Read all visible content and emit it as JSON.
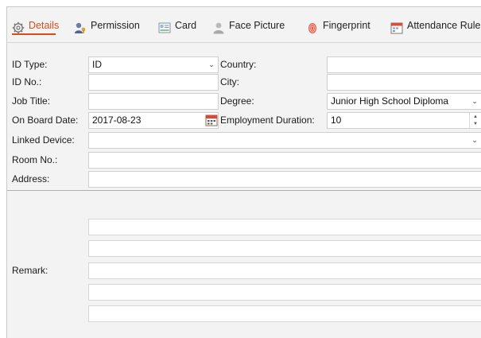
{
  "tabs": [
    {
      "label": "Details",
      "icon": "gear-icon",
      "active": true
    },
    {
      "label": "Permission",
      "icon": "user-key-icon",
      "active": false
    },
    {
      "label": "Card",
      "icon": "card-icon",
      "active": false
    },
    {
      "label": "Face Picture",
      "icon": "person-silhouette-icon",
      "active": false
    },
    {
      "label": "Fingerprint",
      "icon": "fingerprint-icon",
      "active": false
    },
    {
      "label": "Attendance Rule",
      "icon": "calendar-rule-icon",
      "active": false
    }
  ],
  "form": {
    "id_type": {
      "label": "ID Type:",
      "value": "ID"
    },
    "country": {
      "label": "Country:",
      "value": ""
    },
    "id_no": {
      "label": "ID No.:",
      "value": ""
    },
    "city": {
      "label": "City:",
      "value": ""
    },
    "job_title": {
      "label": "Job Title:",
      "value": ""
    },
    "degree": {
      "label": "Degree:",
      "value": "Junior High School Diploma"
    },
    "on_board_date": {
      "label": "On Board Date:",
      "value": "2017-08-23"
    },
    "employment_duration": {
      "label": "Employment Duration:",
      "value": "10"
    },
    "linked_device": {
      "label": "Linked Device:",
      "value": ""
    },
    "room_no": {
      "label": "Room No.:",
      "value": ""
    },
    "address": {
      "label": "Address:",
      "value": ""
    },
    "remark": {
      "label": "Remark:"
    }
  },
  "colors": {
    "accent": "#e04a17",
    "panel": "#f3f3f3",
    "border": "#cfcfcf"
  }
}
